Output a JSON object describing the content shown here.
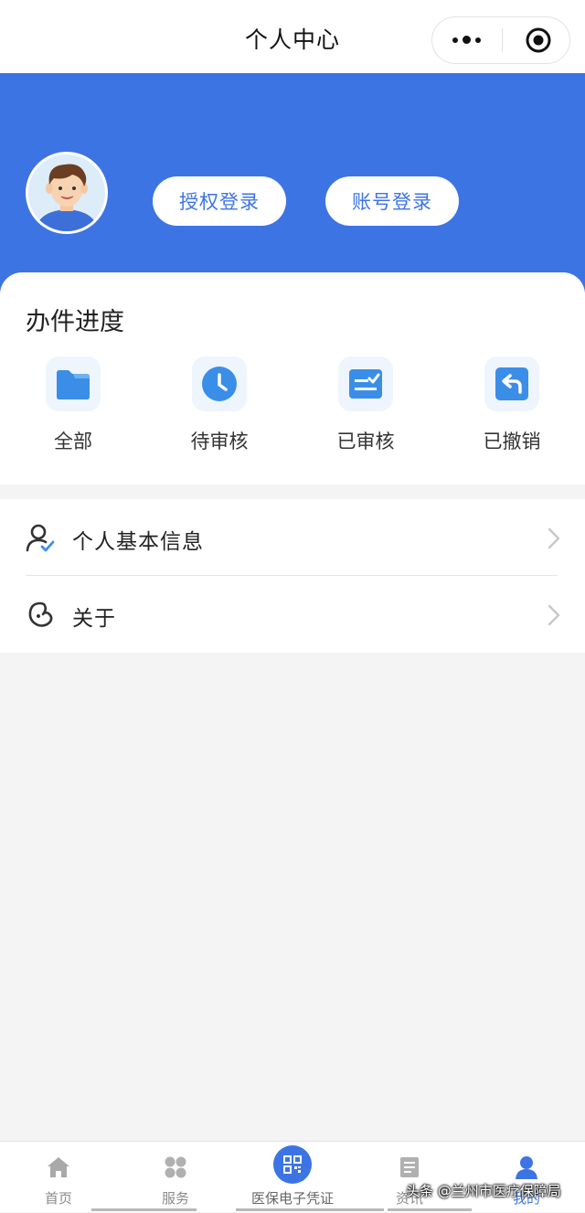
{
  "nav": {
    "title": "个人中心"
  },
  "header": {
    "auth_login_label": "授权登录",
    "account_login_label": "账号登录"
  },
  "progress": {
    "title": "办件进度",
    "items": [
      {
        "label": "全部",
        "icon": "folder-icon"
      },
      {
        "label": "待审核",
        "icon": "clock-icon"
      },
      {
        "label": "已审核",
        "icon": "reviewed-icon"
      },
      {
        "label": "已撤销",
        "icon": "undo-icon"
      }
    ]
  },
  "menu": {
    "items": [
      {
        "label": "个人基本信息",
        "icon": "user-check-icon"
      },
      {
        "label": "关于",
        "icon": "about-icon"
      }
    ]
  },
  "tabbar": {
    "items": [
      {
        "label": "首页",
        "icon": "home-icon"
      },
      {
        "label": "服务",
        "icon": "services-icon"
      },
      {
        "label": "医保电子凭证",
        "icon": "qr-code-icon"
      },
      {
        "label": "资讯",
        "icon": "news-icon"
      },
      {
        "label": "我的",
        "icon": "profile-icon"
      }
    ]
  },
  "watermark": "头条 @兰州市医疗保障局",
  "colors": {
    "primary": "#3d74e4",
    "background": "#f4f4f5",
    "icon_blue": "#3a8ee8"
  }
}
